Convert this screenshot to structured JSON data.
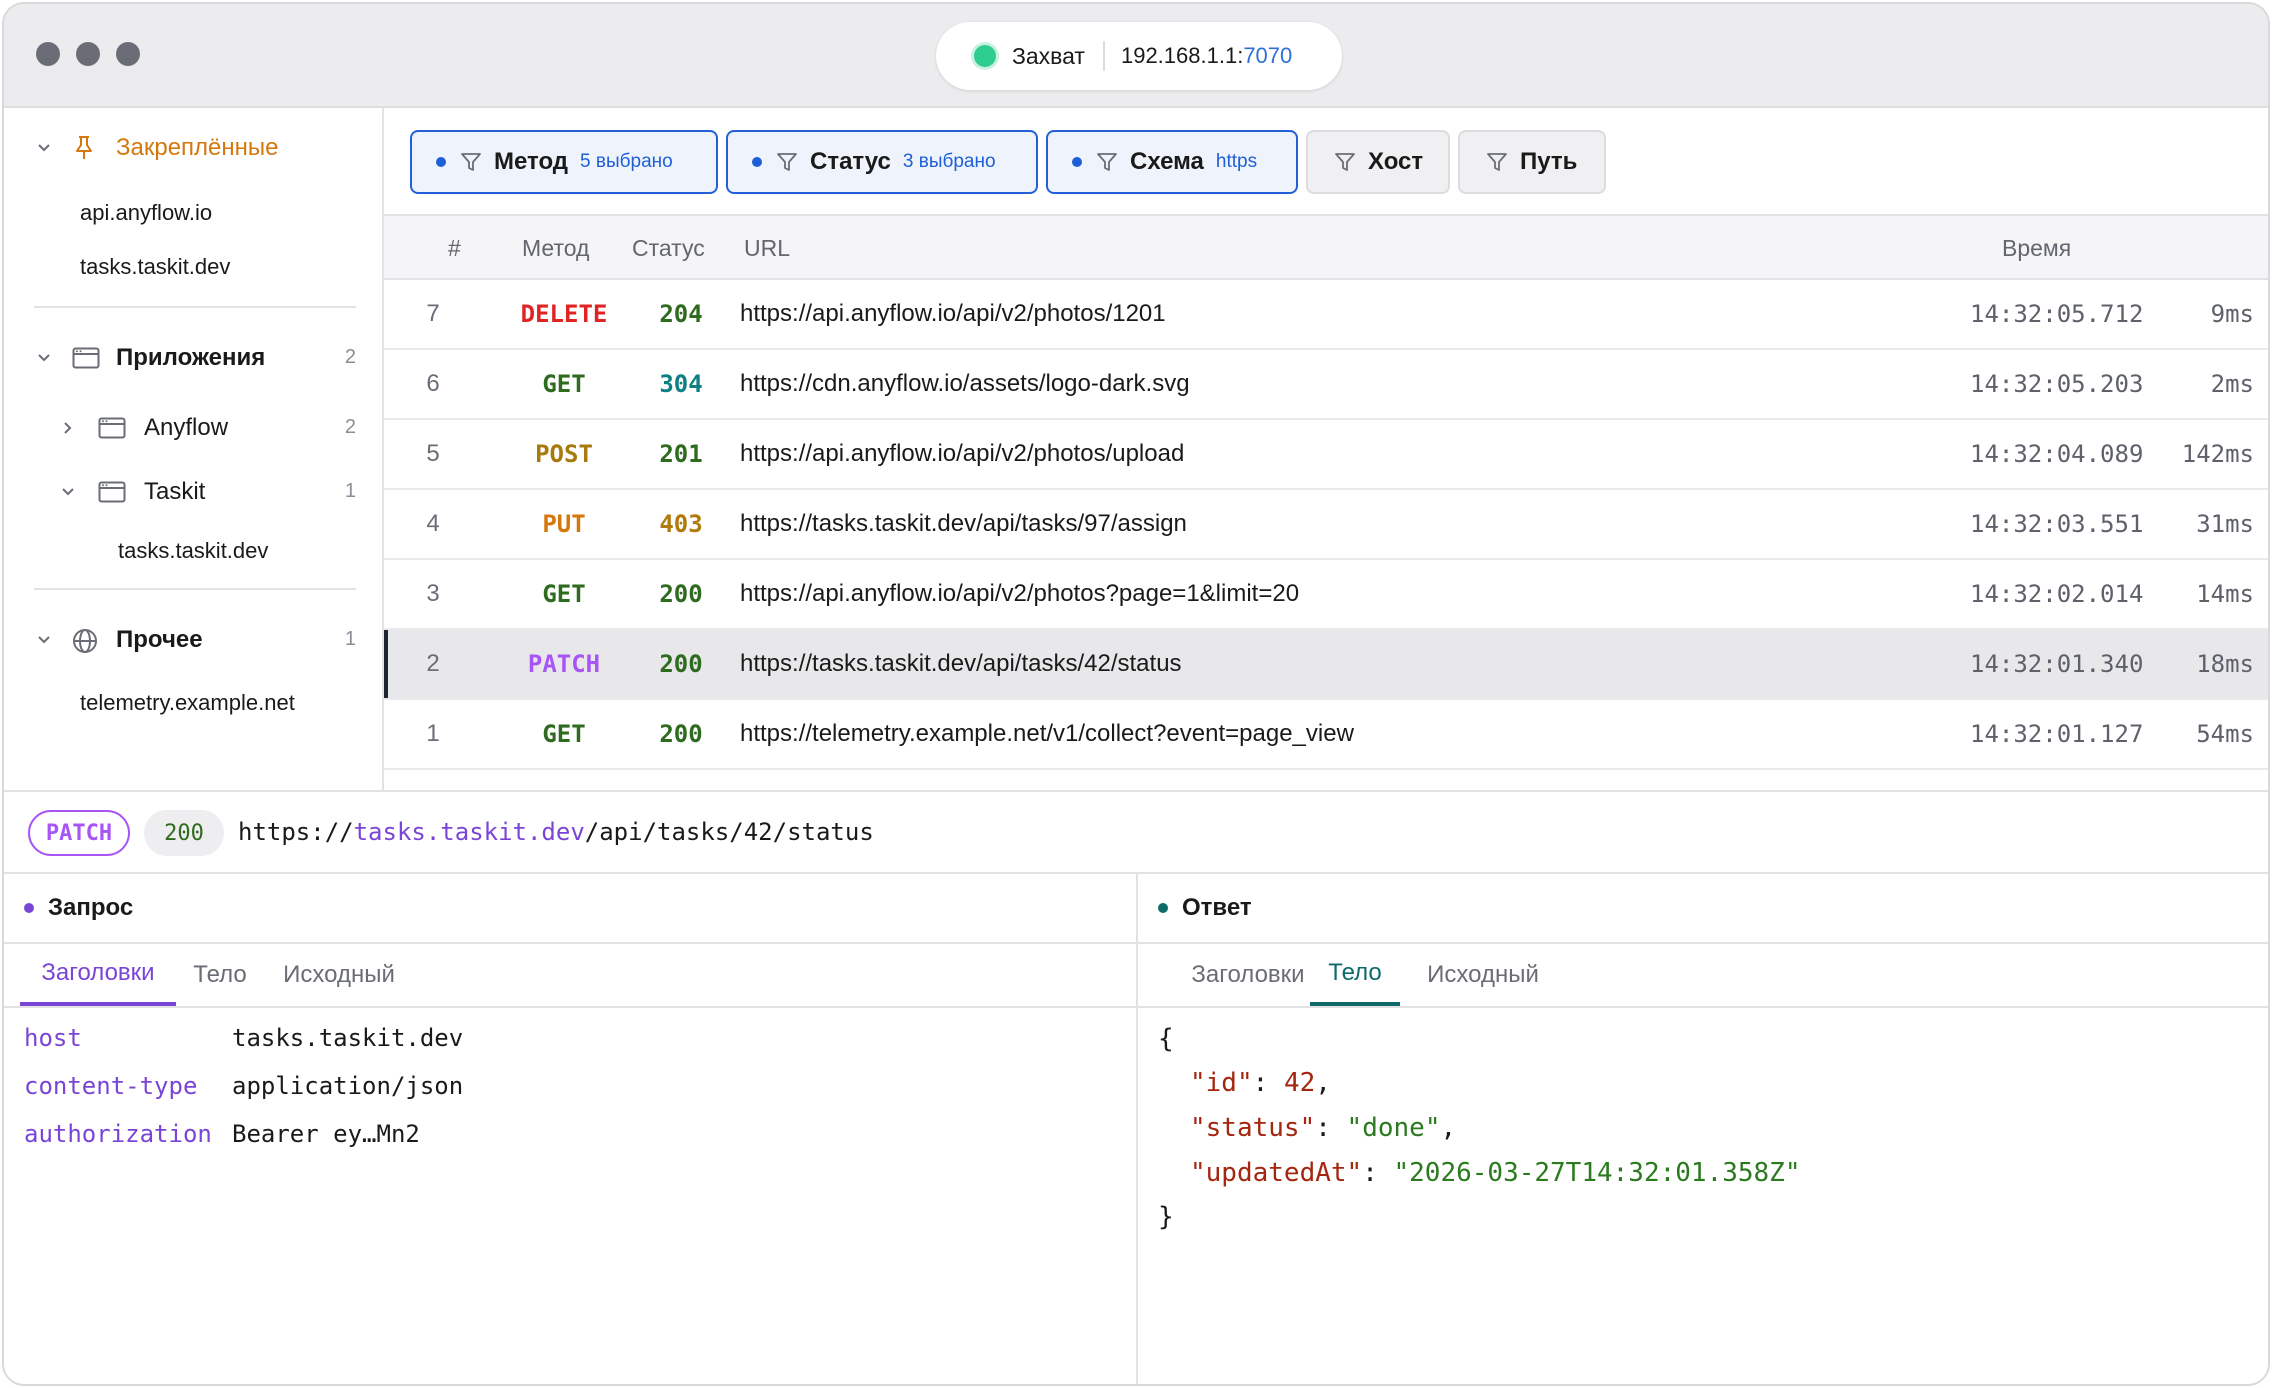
{
  "titlebar": {
    "capture_label": "Захват",
    "address_ip": "192.168.1.1:",
    "address_port": "7070",
    "capture_status_color": "#2ecc8f"
  },
  "sidebar": {
    "pinned": {
      "label": "Закреплённые",
      "icon": "pin-icon",
      "items": [
        "api.anyflow.io",
        "tasks.taskit.dev"
      ]
    },
    "apps": {
      "label": "Приложения",
      "count": "2",
      "icon": "app-window-icon",
      "children": [
        {
          "label": "Anyflow",
          "count": "2",
          "expanded": false
        },
        {
          "label": "Taskit",
          "count": "1",
          "expanded": true,
          "items": [
            "tasks.taskit.dev"
          ]
        }
      ]
    },
    "other": {
      "label": "Прочее",
      "count": "1",
      "icon": "globe-icon",
      "items": [
        "telemetry.example.net"
      ]
    }
  },
  "filters": [
    {
      "label": "Метод",
      "sub": "5 выбрано",
      "active": true
    },
    {
      "label": "Статус",
      "sub": "3 выбрано",
      "active": true
    },
    {
      "label": "Схема",
      "sub": "https",
      "active": true
    },
    {
      "label": "Хост",
      "sub": "",
      "active": false
    },
    {
      "label": "Путь",
      "sub": "",
      "active": false
    }
  ],
  "table": {
    "headers": {
      "num": "#",
      "method": "Метод",
      "status": "Статус",
      "url": "URL",
      "time": "Время"
    },
    "rows": [
      {
        "num": "7",
        "method": "DELETE",
        "status": "204",
        "url": "https://api.anyflow.io/api/v2/photos/1201",
        "time": "14:32:05.712",
        "duration": "9ms"
      },
      {
        "num": "6",
        "method": "GET",
        "status": "304",
        "url": "https://cdn.anyflow.io/assets/logo-dark.svg",
        "time": "14:32:05.203",
        "duration": "2ms"
      },
      {
        "num": "5",
        "method": "POST",
        "status": "201",
        "url": "https://api.anyflow.io/api/v2/photos/upload",
        "time": "14:32:04.089",
        "duration": "142ms"
      },
      {
        "num": "4",
        "method": "PUT",
        "status": "403",
        "url": "https://tasks.taskit.dev/api/tasks/97/assign",
        "time": "14:32:03.551",
        "duration": "31ms"
      },
      {
        "num": "3",
        "method": "GET",
        "status": "200",
        "url": "https://api.anyflow.io/api/v2/photos?page=1&limit=20",
        "time": "14:32:02.014",
        "duration": "14ms"
      },
      {
        "num": "2",
        "method": "PATCH",
        "status": "200",
        "url": "https://tasks.taskit.dev/api/tasks/42/status",
        "time": "14:32:01.340",
        "duration": "18ms"
      },
      {
        "num": "1",
        "method": "GET",
        "status": "200",
        "url": "https://telemetry.example.net/v1/collect?event=page_view",
        "time": "14:32:01.127",
        "duration": "54ms"
      }
    ],
    "selected_num": "2"
  },
  "colors": {
    "DELETE": "#e02424",
    "GET": "#2e6b1e",
    "POST": "#a87a0c",
    "PUT": "#d4780e",
    "PATCH": "#a855f7",
    "s204": "#2e6b1e",
    "s304": "#0f7f86",
    "s201": "#2e6b1e",
    "s403": "#b07a0c",
    "s200": "#2e6b1e"
  },
  "selected": {
    "method": "PATCH",
    "status": "200",
    "url_scheme": "https://",
    "url_host": "tasks.taskit.dev",
    "url_path": "/api/tasks/42/status"
  },
  "request": {
    "title": "Запрос",
    "tabs": [
      "Заголовки",
      "Тело",
      "Исходный"
    ],
    "active_tab": "Заголовки",
    "headers": [
      {
        "key": "host",
        "value": "tasks.taskit.dev"
      },
      {
        "key": "content-type",
        "value": "application/json"
      },
      {
        "key": "authorization",
        "value": "Bearer ey…Mn2"
      }
    ]
  },
  "response": {
    "title": "Ответ",
    "tabs": [
      "Заголовки",
      "Тело",
      "Исходный"
    ],
    "active_tab": "Тело",
    "body": {
      "open": "{",
      "close": "}",
      "fields": [
        {
          "key": "\"id\"",
          "value": "42",
          "type": "number",
          "comma": ","
        },
        {
          "key": "\"status\"",
          "value": "\"done\"",
          "type": "string",
          "comma": ","
        },
        {
          "key": "\"updatedAt\"",
          "value": "\"2026-03-27T14:32:01.358Z\"",
          "type": "string",
          "comma": ""
        }
      ]
    }
  }
}
